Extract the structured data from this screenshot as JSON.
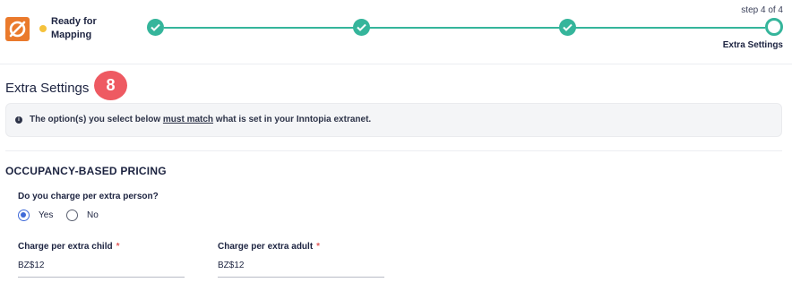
{
  "header": {
    "status_text": "Ready for Mapping",
    "step_count": "step 4 of 4",
    "step_name": "Extra Settings",
    "accent_color": "#35b59b",
    "status_color": "#f5c23c",
    "logo_color": "#ea7a2c"
  },
  "main": {
    "title": "Extra Settings",
    "badge": "8",
    "notice": {
      "before": "The option(s) you select below ",
      "emphasis": "must match",
      "after": " what is set in your Inntopia extranet.",
      "icon": "info-icon"
    },
    "section_title": "OCCUPANCY-BASED PRICING",
    "question": "Do you charge per extra person?",
    "options": {
      "yes": "Yes",
      "no": "No",
      "selected": "Yes"
    },
    "fields": {
      "child_label": "Charge per extra child",
      "child_value": "BZ$12",
      "adult_label": "Charge per extra adult",
      "adult_value": "BZ$12",
      "required_mark": "*"
    }
  }
}
